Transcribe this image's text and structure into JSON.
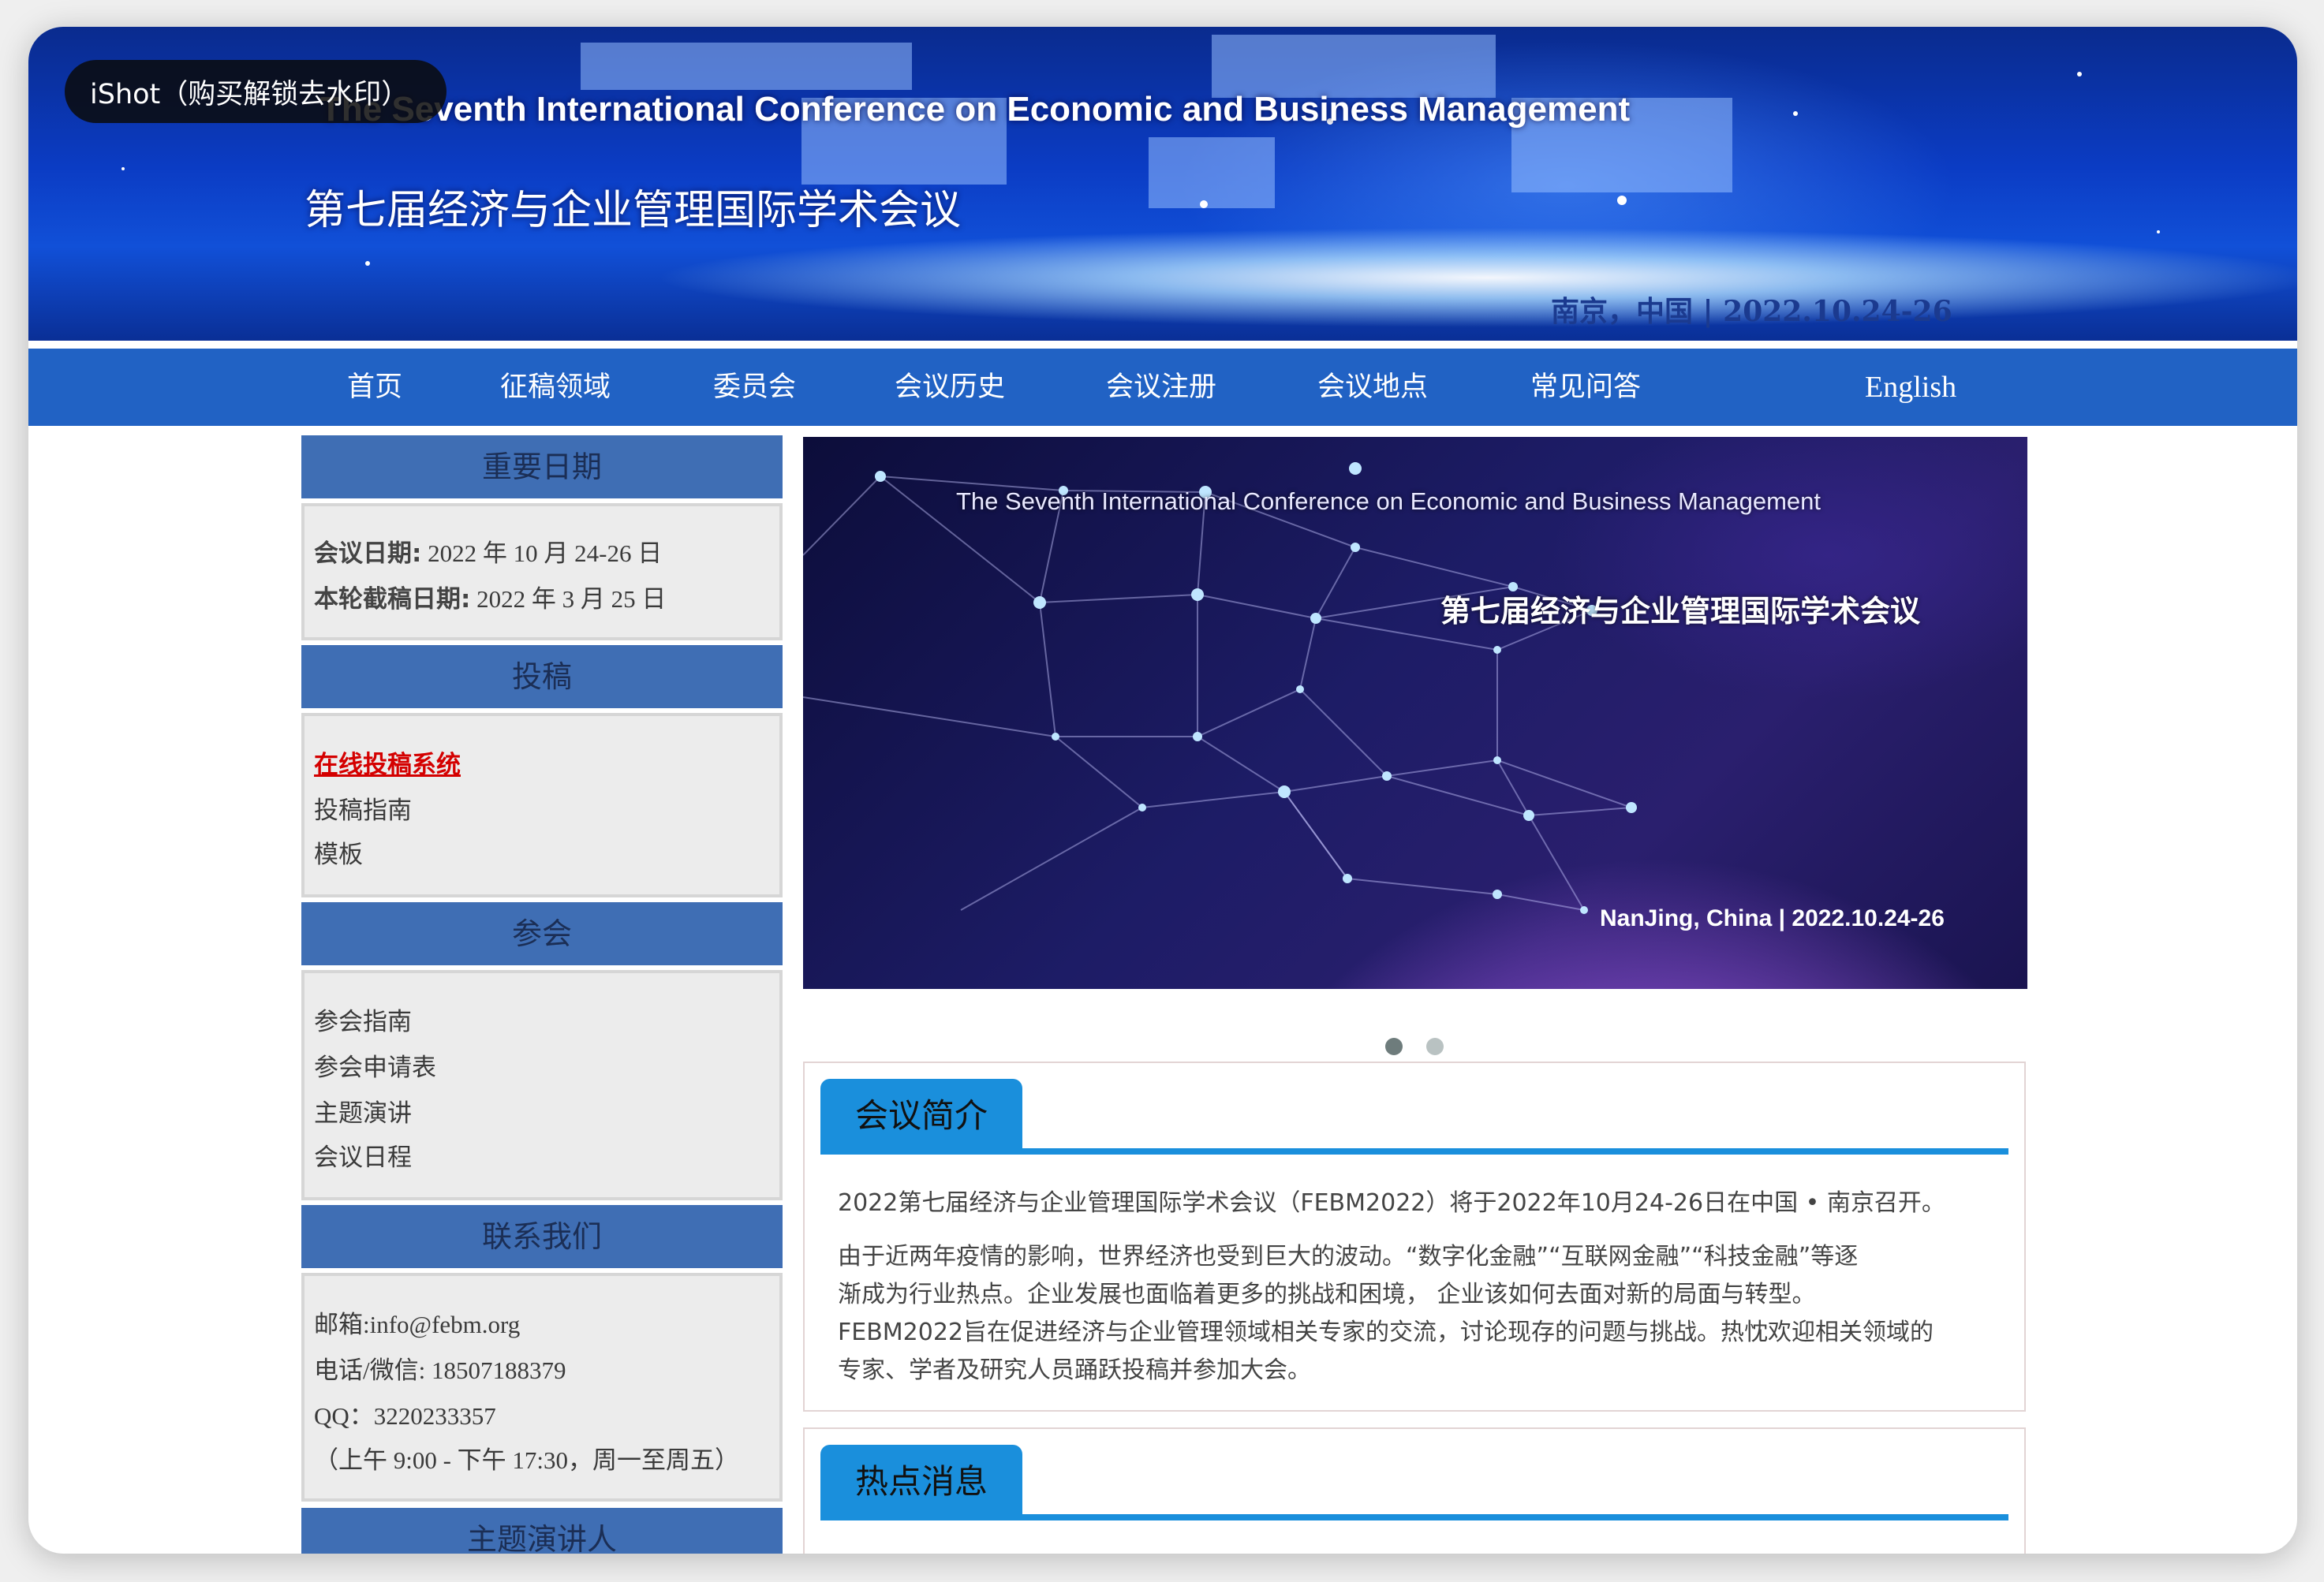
{
  "watermark": "iShot（购买解锁去水印）",
  "banner": {
    "title_en": "The Seventh International Conference on Economic and Business Management",
    "title_cn": "第七届经济与企业管理国际学术会议",
    "location": "南京，中国 | 2022.10.24-26"
  },
  "nav": [
    "首页",
    "征稿领域",
    "委员会",
    "会议历史",
    "会议注册",
    "会议地点",
    "常见问答",
    "English"
  ],
  "sidebar": {
    "dates": {
      "heading": "重要日期",
      "conf_label": "会议日期:",
      "conf_value": " 2022 年 10 月 24-26 日",
      "deadline_label": "本轮截稿日期:",
      "deadline_value": " 2022 年 3 月 25 日"
    },
    "submit": {
      "heading": "投稿",
      "online": "在线投稿系统",
      "guide": "投稿指南",
      "template": "模板"
    },
    "attend": {
      "heading": "参会",
      "items": [
        "参会指南",
        "参会申请表",
        "主题演讲",
        "会议日程"
      ]
    },
    "contact": {
      "heading": "联系我们",
      "email": "邮箱:info@febm.org",
      "phone": "电话/微信: 18507188379",
      "qq": "QQ：3220233357",
      "hours": "（上午 9:00 - 下午 17:30，周一至周五）"
    },
    "speakers": {
      "heading": "主题演讲人"
    }
  },
  "slider": {
    "title_en": "The Seventh International Conference on Economic and Business Management",
    "title_cn": "第七届经济与企业管理国际学术会议",
    "location": "NanJing, China | 2022.10.24-26",
    "active_dot": 1,
    "dot_count": 2
  },
  "intro": {
    "tab": "会议简介",
    "p1": "2022第七届经济与企业管理国际学术会议（FEBM2022）将于2022年10月24-26日在中国 • 南京召开。",
    "p2_lines": [
      "由于近两年疫情的影响，世界经济也受到巨大的波动。“数字化金融”“互联网金融”“科技金融”等逐",
      "渐成为行业热点。企业发展也面临着更多的挑战和困境， 企业该如何去面对新的局面与转型。",
      "FEBM2022旨在促进经济与企业管理领域相关专家的交流，讨论现存的问题与挑战。热忱欢迎相关领域的",
      "专家、学者及研究人员踊跃投稿并参加大会。"
    ]
  },
  "news": {
    "tab": "热点消息"
  },
  "colors": {
    "nav": "#2162c4",
    "side_head": "#3f6eb4",
    "tab": "#1a8fdc",
    "link_red": "#d40000"
  }
}
